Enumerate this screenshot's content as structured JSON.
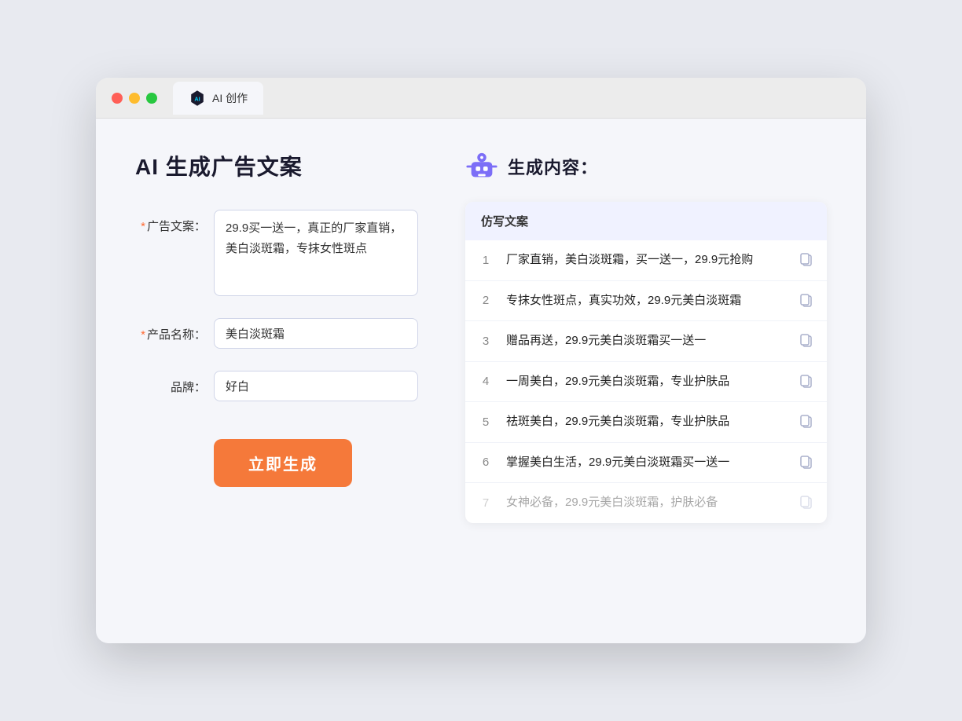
{
  "browser": {
    "tab_label": "AI 创作"
  },
  "page": {
    "title": "AI 生成广告文案",
    "result_title": "生成内容："
  },
  "form": {
    "ad_copy_label": "广告文案：",
    "ad_copy_required": "*",
    "ad_copy_value": "29.9买一送一，真正的厂家直销，美白淡斑霜，专抹女性斑点",
    "product_name_label": "产品名称：",
    "product_name_required": "*",
    "product_name_value": "美白淡斑霜",
    "brand_label": "品牌：",
    "brand_value": "好白",
    "generate_button": "立即生成"
  },
  "table": {
    "header": "仿写文案",
    "rows": [
      {
        "num": "1",
        "text": "厂家直销，美白淡斑霜，买一送一，29.9元抢购",
        "faded": false
      },
      {
        "num": "2",
        "text": "专抹女性斑点，真实功效，29.9元美白淡斑霜",
        "faded": false
      },
      {
        "num": "3",
        "text": "赠品再送，29.9元美白淡斑霜买一送一",
        "faded": false
      },
      {
        "num": "4",
        "text": "一周美白，29.9元美白淡斑霜，专业护肤品",
        "faded": false
      },
      {
        "num": "5",
        "text": "祛斑美白，29.9元美白淡斑霜，专业护肤品",
        "faded": false
      },
      {
        "num": "6",
        "text": "掌握美白生活，29.9元美白淡斑霜买一送一",
        "faded": false
      },
      {
        "num": "7",
        "text": "女神必备，29.9元美白淡斑霜，护肤必备",
        "faded": true
      }
    ]
  }
}
